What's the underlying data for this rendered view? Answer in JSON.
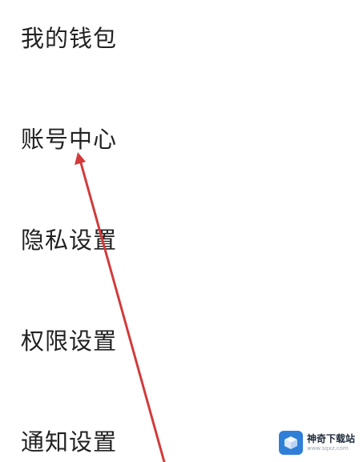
{
  "menu": {
    "items": [
      {
        "label": "我的钱包"
      },
      {
        "label": "账号中心"
      },
      {
        "label": "隐私设置"
      },
      {
        "label": "权限设置"
      },
      {
        "label": "通知设置"
      }
    ]
  },
  "annotation": {
    "arrow_color": "#d23b3b",
    "target": "账号中心"
  },
  "watermark": {
    "title": "神奇下载站",
    "subtitle": "www.sqxz.com",
    "logo_color": "#2f7fd8"
  }
}
